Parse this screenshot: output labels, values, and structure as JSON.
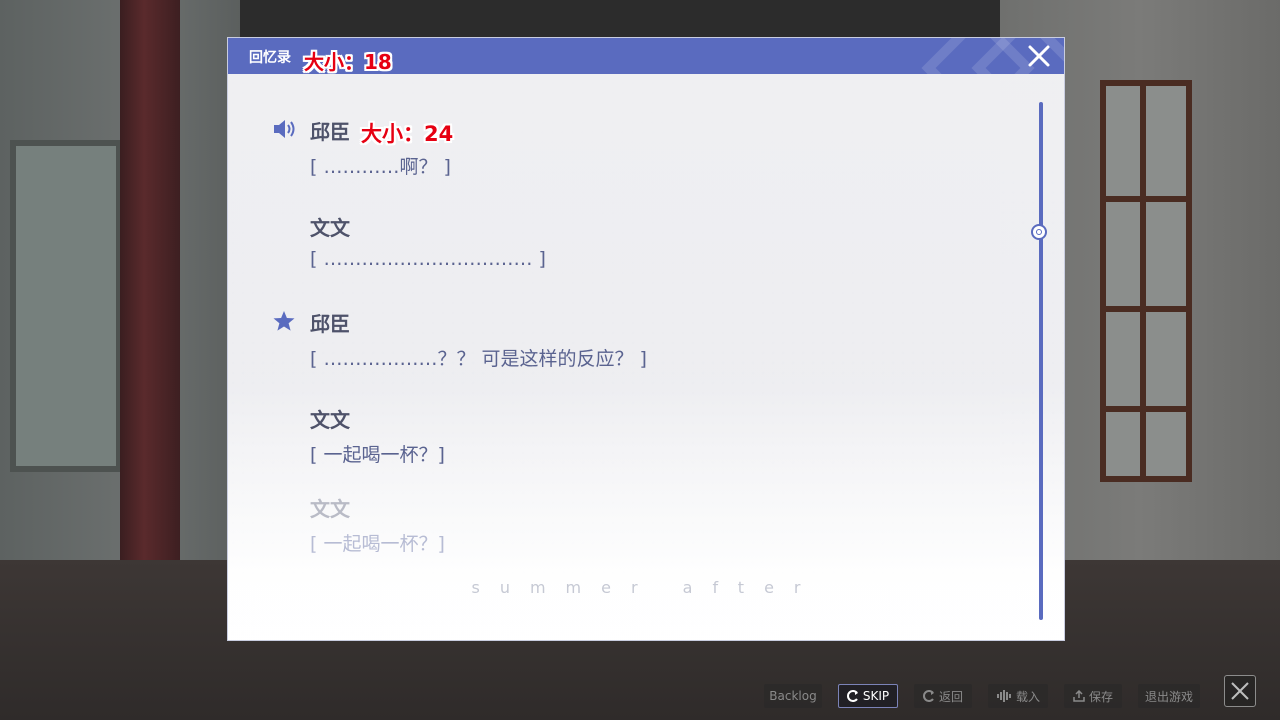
{
  "backlog": {
    "title": "回忆录",
    "header_size_label": "大小：18",
    "entry_size_label": "大小：24",
    "entries": [
      {
        "name": "邱臣",
        "text": "[ …………啊？ ]",
        "icon": "speaker-icon"
      },
      {
        "name": "文文",
        "text": "[ …………………………… ]",
        "icon": ""
      },
      {
        "name": "邱臣",
        "text": "[ ………………？？ 可是这样的反应？ ]",
        "icon": "star-icon"
      },
      {
        "name": "文文",
        "text": "[ 一起喝一杯？]",
        "icon": ""
      },
      {
        "name": "文文",
        "text": "[ 一起喝一杯？]",
        "icon": ""
      }
    ],
    "watermark": "summer   after",
    "scroll_position": 0.25
  },
  "toolbar": {
    "backlog": "Backlog",
    "skip": "SKIP",
    "back": "返回",
    "load": "载入",
    "save": "保存",
    "exit": "退出游戏"
  },
  "colors": {
    "accent": "#5a6bbf",
    "badge_red": "#e60012",
    "name_text": "#4e526a",
    "line_text": "#5a6390"
  }
}
